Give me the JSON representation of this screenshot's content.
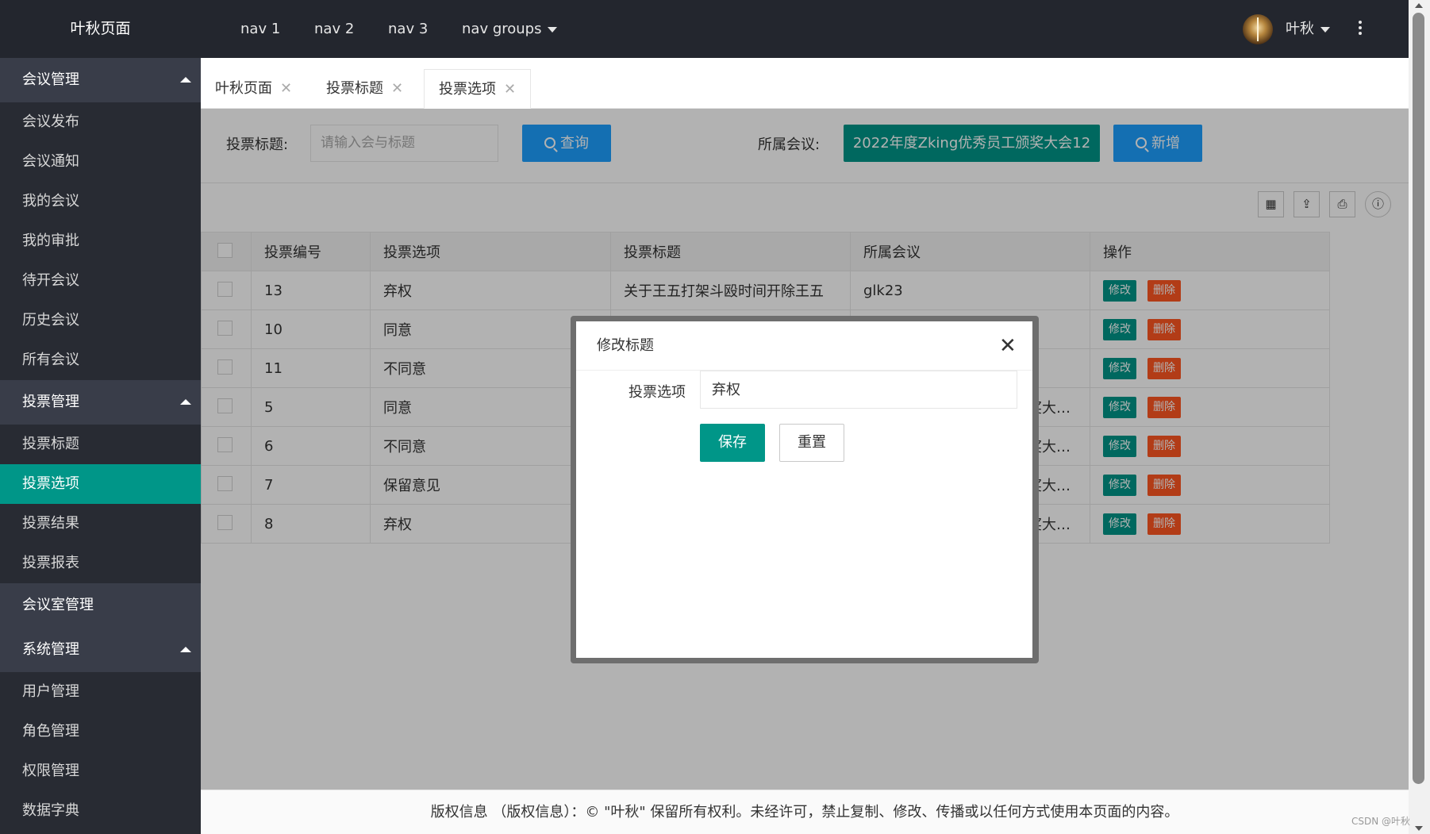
{
  "app": {
    "logo": "叶秋页面"
  },
  "sidebar": {
    "groups": [
      {
        "label": "会议管理",
        "items": [
          "会议发布",
          "会议通知",
          "我的会议",
          "我的审批",
          "待开会议",
          "历史会议",
          "所有会议"
        ]
      },
      {
        "label": "投票管理",
        "items": [
          "投票标题",
          "投票选项",
          "投票结果",
          "投票报表"
        ],
        "active": "投票选项"
      },
      {
        "label": "会议室管理",
        "items": []
      },
      {
        "label": "系统管理",
        "items": [
          "用户管理",
          "角色管理",
          "权限管理",
          "数据字典"
        ]
      }
    ]
  },
  "header": {
    "nav": [
      "nav 1",
      "nav 2",
      "nav 3",
      "nav groups"
    ],
    "user": "叶秋"
  },
  "tabs": [
    {
      "label": "叶秋页面",
      "close": "✕"
    },
    {
      "label": "投票标题",
      "close": "✕"
    },
    {
      "label": "投票选项",
      "close": "✕",
      "active": true
    }
  ],
  "search": {
    "title_label": "投票标题:",
    "title_placeholder": "请输入会与标题",
    "query_button": "查询",
    "meeting_label": "所属会议:",
    "meeting_value": "2022年度Zking优秀员工颁奖大会12",
    "add_button": "新增"
  },
  "toolbar_icons": [
    "columns-icon",
    "export-icon",
    "print-icon",
    "info-icon"
  ],
  "table": {
    "headers": [
      "投票编号",
      "投票选项",
      "投票标题",
      "所属会议",
      "操作"
    ],
    "rows": [
      {
        "id": "13",
        "option": "弃权",
        "title": "关于王五打架斗殴时间开除王五",
        "meeting": "glk23"
      },
      {
        "id": "10",
        "option": "同意",
        "title": "",
        "meeting": ""
      },
      {
        "id": "11",
        "option": "不同意",
        "title": "",
        "meeting": ""
      },
      {
        "id": "5",
        "option": "同意",
        "title": "",
        "meeting": "奖大…"
      },
      {
        "id": "6",
        "option": "不同意",
        "title": "",
        "meeting": "奖大…"
      },
      {
        "id": "7",
        "option": "保留意见",
        "title": "",
        "meeting": "奖大…"
      },
      {
        "id": "8",
        "option": "弃权",
        "title": "",
        "meeting": "奖大…"
      }
    ],
    "edit_label": "修改",
    "delete_label": "删除"
  },
  "footer": {
    "text": "版权信息 （版权信息）：© \"叶秋\" 保留所有权利。未经许可，禁止复制、修改、传播或以任何方式使用本页面的内容。"
  },
  "modal": {
    "title": "修改标题",
    "close": "✕",
    "field_label": "投票选项",
    "field_value": "弃权",
    "save": "保存",
    "reset": "重置"
  },
  "watermark": "CSDN @叶秋",
  "colors": {
    "sidebar": "#282b33",
    "header": "#23262e",
    "accent": "#009688",
    "blue": "#1e9fff",
    "danger": "#ff5722"
  }
}
